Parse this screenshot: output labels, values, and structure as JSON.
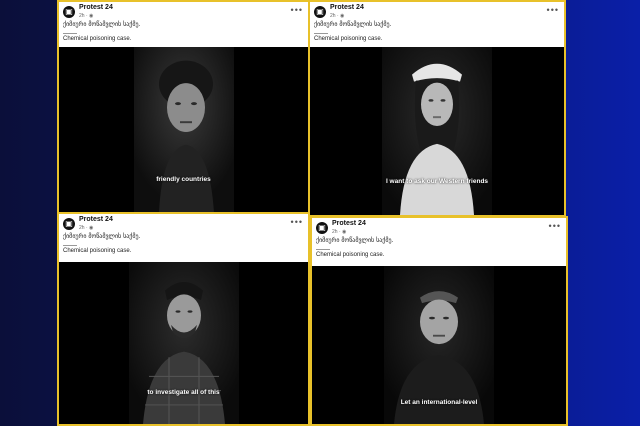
{
  "posts": [
    {
      "page_name": "Protest 24",
      "time": "2h · ◉",
      "text_georgian": "ქიმიური მოწამვლის საქმე.",
      "text_english": "Chemical poisoning case.",
      "caption": "friendly countries"
    },
    {
      "page_name": "Protest 24",
      "time": "2h · ◉",
      "text_georgian": "ქიმიური მოწამვლის საქმე.",
      "text_english": "Chemical poisoning case.",
      "caption": "I want to ask our Western friends"
    },
    {
      "page_name": "Protest 24",
      "time": "2h · ◉",
      "text_georgian": "ქიმიური მოწამვლის საქმე.",
      "text_english": "Chemical poisoning case.",
      "caption": "to investigate all of this"
    },
    {
      "page_name": "Protest 24",
      "time": "2h · ◉",
      "text_georgian": "ქიმიური მოწამვლის საქმე.",
      "text_english": "Chemical poisoning case.",
      "caption": "Let an international-level"
    }
  ]
}
